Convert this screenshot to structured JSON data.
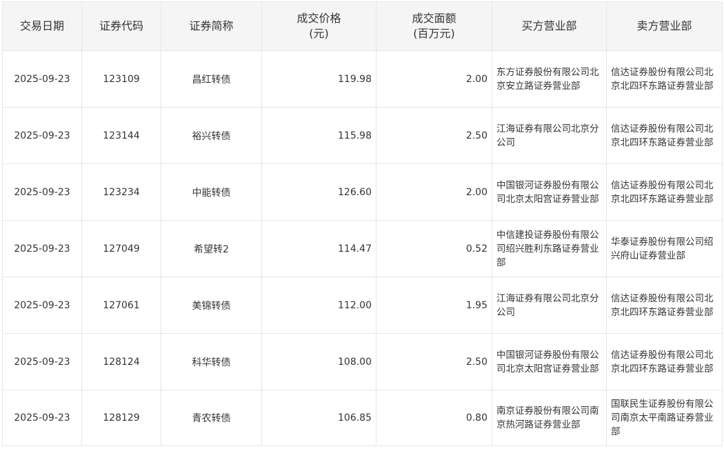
{
  "header": {
    "date": "交易日期",
    "code": "证券代码",
    "name": "证券简称",
    "price_line1": "成交价格",
    "price_line2": "(元)",
    "amount_line1": "成交面额",
    "amount_line2": "(百万元)",
    "buyer": "买方营业部",
    "seller": "卖方营业部"
  },
  "rows": [
    {
      "date": "2025-09-23",
      "code": "123109",
      "name": "昌红转债",
      "price": "119.98",
      "amount": "2.00",
      "buyer": "东方证券股份有限公司北京安立路证券营业部",
      "seller": "信达证券股份有限公司北京北四环东路证券营业部"
    },
    {
      "date": "2025-09-23",
      "code": "123144",
      "name": "裕兴转债",
      "price": "115.98",
      "amount": "2.50",
      "buyer": "江海证券有限公司北京分公司",
      "seller": "信达证券股份有限公司北京北四环东路证券营业部"
    },
    {
      "date": "2025-09-23",
      "code": "123234",
      "name": "中能转债",
      "price": "126.60",
      "amount": "2.00",
      "buyer": "中国银河证券股份有限公司北京太阳宫证券营业部",
      "seller": "信达证券股份有限公司北京北四环东路证券营业部"
    },
    {
      "date": "2025-09-23",
      "code": "127049",
      "name": "希望转2",
      "price": "114.47",
      "amount": "0.52",
      "buyer": "中信建投证券股份有限公司绍兴胜利东路证券营业部",
      "seller": "华泰证券股份有限公司绍兴府山证券营业部"
    },
    {
      "date": "2025-09-23",
      "code": "127061",
      "name": "美锦转债",
      "price": "112.00",
      "amount": "1.95",
      "buyer": "江海证券有限公司北京分公司",
      "seller": "信达证券股份有限公司北京北四环东路证券营业部"
    },
    {
      "date": "2025-09-23",
      "code": "128124",
      "name": "科华转债",
      "price": "108.00",
      "amount": "2.50",
      "buyer": "中国银河证券股份有限公司北京太阳宫证券营业部",
      "seller": "信达证券股份有限公司北京北四环东路证券营业部"
    },
    {
      "date": "2025-09-23",
      "code": "128129",
      "name": "青农转债",
      "price": "106.85",
      "amount": "0.80",
      "buyer": "南京证券股份有限公司南京热河路证券营业部",
      "seller": "国联民生证券股份有限公司南京太平南路证券营业部"
    }
  ]
}
